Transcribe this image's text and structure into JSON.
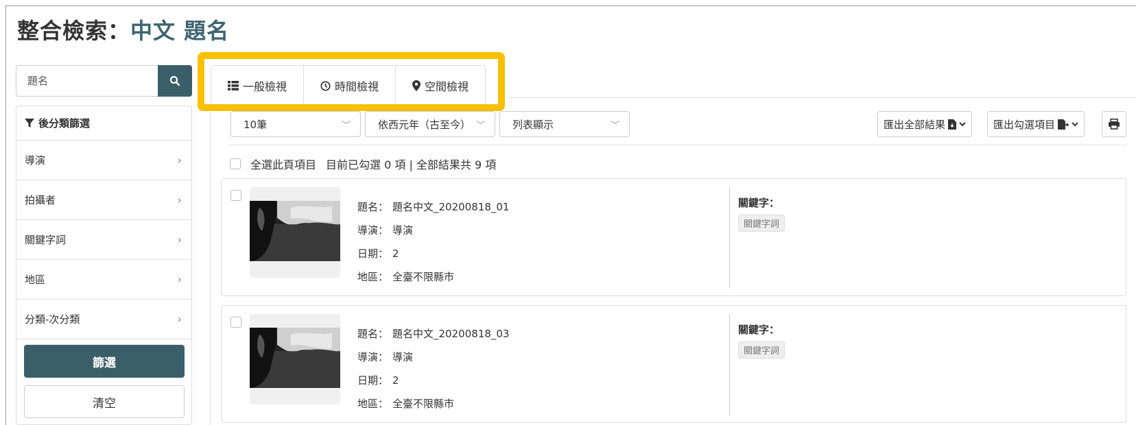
{
  "title": {
    "prefix": "整合檢索：",
    "query": "中文 題名"
  },
  "search": {
    "value": "題名",
    "icon": "search-icon"
  },
  "filter": {
    "heading": "後分類篩選",
    "items": [
      {
        "label": "導演"
      },
      {
        "label": "拍攝者"
      },
      {
        "label": "關鍵字詞"
      },
      {
        "label": "地區"
      },
      {
        "label": "分類-次分類"
      }
    ],
    "apply_label": "篩選",
    "clear_label": "清空"
  },
  "tabs": [
    {
      "label": "一般檢視",
      "icon": "list-icon"
    },
    {
      "label": "時間檢視",
      "icon": "clock-icon"
    },
    {
      "label": "空間檢視",
      "icon": "map-marker-icon"
    }
  ],
  "toolbar": {
    "page_size": "10筆",
    "sort": "依西元年（古至今）",
    "display": "列表顯示",
    "export_all": "匯出全部結果",
    "export_selected": "匯出勾選項目"
  },
  "selection": {
    "select_all_label": "全選此頁項目",
    "status": "目前已勾選 0 項 | 全部結果共 9 項"
  },
  "results": [
    {
      "title_label": "題名：",
      "title": "題名中文_20200818_01",
      "director_label": "導演：",
      "director": "導演",
      "date_label": "日期：",
      "date": "2",
      "region_label": "地區：",
      "region": "全臺不限縣市",
      "keyword_heading": "關鍵字：",
      "keyword": "關鍵字詞"
    },
    {
      "title_label": "題名：",
      "title": "題名中文_20200818_03",
      "director_label": "導演：",
      "director": "導演",
      "date_label": "日期：",
      "date": "2",
      "region_label": "地區：",
      "region": "全臺不限縣市",
      "keyword_heading": "關鍵字：",
      "keyword": "關鍵字詞"
    }
  ],
  "colors": {
    "accent": "#3b5f69",
    "highlight": "#f8c000"
  }
}
